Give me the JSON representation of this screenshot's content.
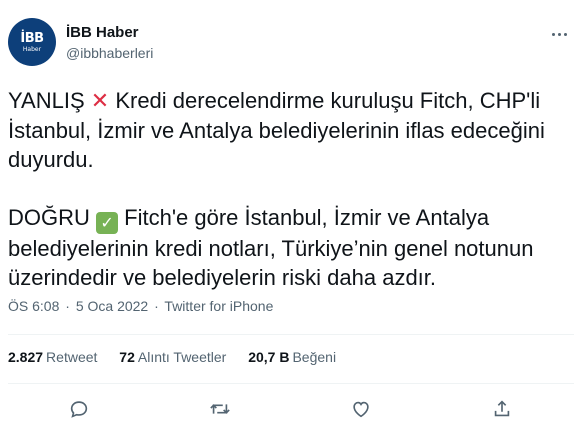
{
  "author": {
    "name": "İBB Haber",
    "handle": "@ibbhaberleri",
    "avatar_top": "İBB",
    "avatar_bottom": "Haber"
  },
  "tweet": {
    "p1_word": "YANLIŞ",
    "p1_emoji": "✕",
    "p1_text": "Kredi derecelendirme kuruluşu Fitch, CHP'li İstanbul, İzmir ve Antalya belediyelerinin iflas edeceğini duyurdu.",
    "p2_word": "DOĞRU",
    "p2_emoji": "✓",
    "p2_text": "Fitch'e göre İstanbul, İzmir ve Antalya belediyelerinin kredi notları, Türkiye’nin genel notunun üzerindedir ve belediyelerin riski daha azdır."
  },
  "meta": {
    "time": "ÖS 6:08",
    "sep1": "·",
    "date": "5 Oca 2022",
    "sep2": "·",
    "source": "Twitter for iPhone"
  },
  "stats": {
    "retweets_count": "2.827",
    "retweets_label": "Retweet",
    "quotes_count": "72",
    "quotes_label": "Alıntı Tweetler",
    "likes_count": "20,7 B",
    "likes_label": "Beğeni"
  },
  "icons": {
    "reply": "reply-icon",
    "retweet": "retweet-icon",
    "like": "heart-icon",
    "share": "share-icon",
    "more": "more-icon"
  },
  "colors": {
    "text": "#0f1419",
    "secondary": "#536471",
    "avatar_bg": "#0d3f7a",
    "cross": "#dd2e44",
    "check": "#77b255"
  }
}
